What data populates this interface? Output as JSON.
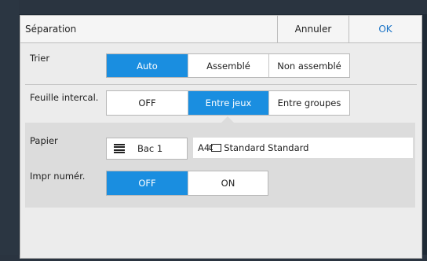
{
  "dialog": {
    "title": "Séparation",
    "cancel_label": "Annuler",
    "ok_label": "OK"
  },
  "sort": {
    "label": "Trier",
    "options": [
      "Auto",
      "Assemblé",
      "Non assemblé"
    ],
    "selected": "Auto"
  },
  "separator": {
    "label": "Feuille intercal.",
    "options": [
      "OFF",
      "Entre jeux",
      "Entre groupes"
    ],
    "selected": "Entre jeux"
  },
  "paper": {
    "label": "Papier",
    "tray_label": "Bac 1",
    "size": "A4",
    "type_text": "Standard Standard"
  },
  "numbering": {
    "label": "Impr numér.",
    "options": [
      "OFF",
      "ON"
    ],
    "selected": "OFF"
  },
  "colors": {
    "accent": "#1a8ee0",
    "ok_text": "#1a73c6"
  }
}
